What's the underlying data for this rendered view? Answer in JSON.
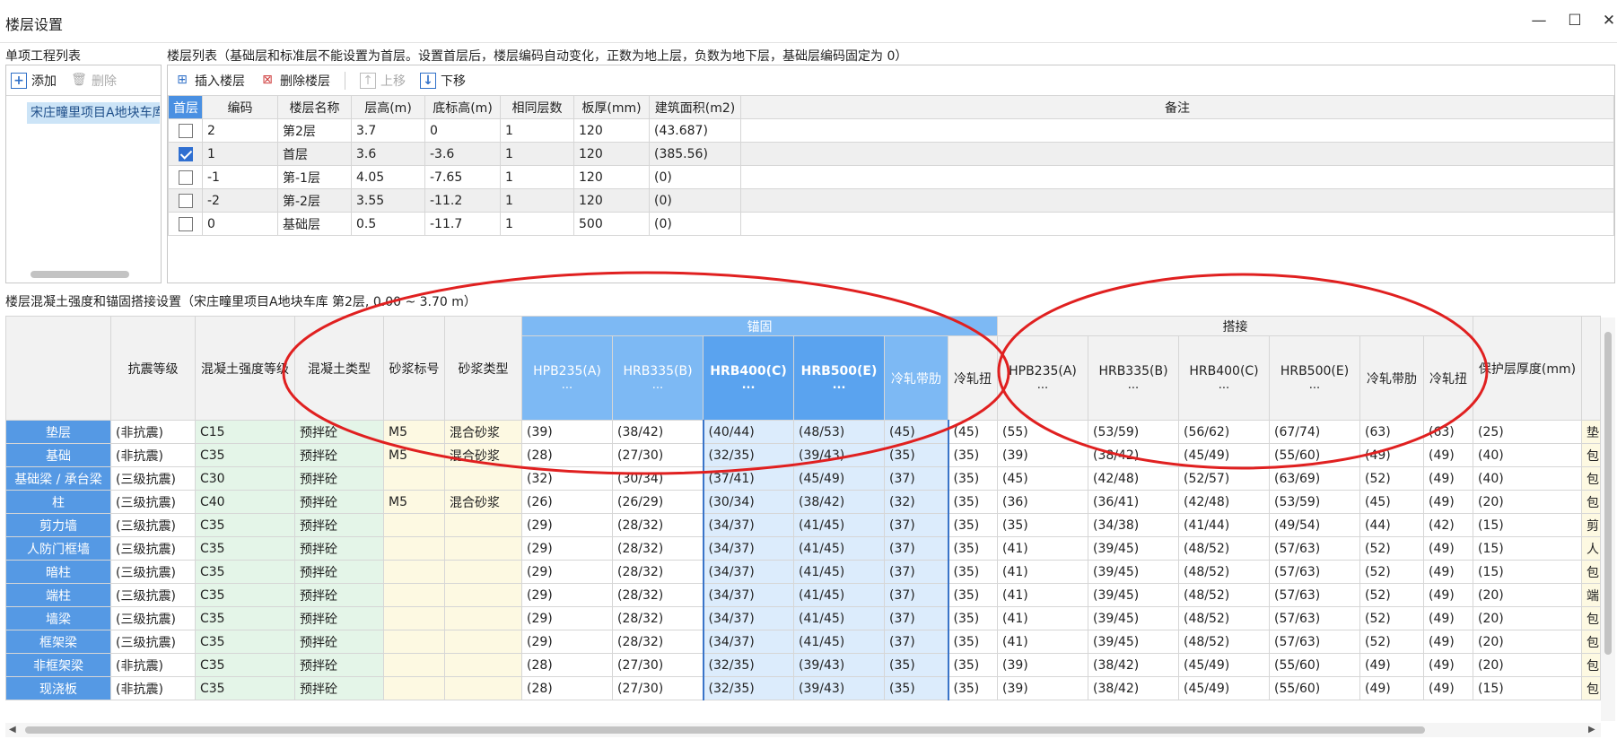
{
  "window": {
    "title": "楼层设置",
    "minimize": "—",
    "maximize": "☐",
    "close": "✕"
  },
  "project_list": {
    "label": "单项工程列表",
    "add": "添加",
    "delete": "删除",
    "items": [
      "宋庄疃里项目A地块车库"
    ]
  },
  "floor_list": {
    "label": "楼层列表（基础层和标准层不能设置为首层。设置首层后，楼层编码自动变化，正数为地上层，负数为地下层，基础层编码固定为 0）",
    "toolbar": {
      "insert": "插入楼层",
      "delete": "删除楼层",
      "up": "上移",
      "down": "下移"
    },
    "columns": [
      "首层",
      "编码",
      "楼层名称",
      "层高(m)",
      "底标高(m)",
      "相同层数",
      "板厚(mm)",
      "建筑面积(m2)",
      "备注"
    ],
    "rows": [
      {
        "first": false,
        "code": "2",
        "name": "第2层",
        "height": "3.7",
        "bottom": "0",
        "same": "1",
        "slab": "120",
        "area": "(43.687)",
        "note": ""
      },
      {
        "first": true,
        "code": "1",
        "name": "首层",
        "height": "3.6",
        "bottom": "-3.6",
        "same": "1",
        "slab": "120",
        "area": "(385.56)",
        "note": ""
      },
      {
        "first": false,
        "code": "-1",
        "name": "第-1层",
        "height": "4.05",
        "bottom": "-7.65",
        "same": "1",
        "slab": "120",
        "area": "(0)",
        "note": ""
      },
      {
        "first": false,
        "code": "-2",
        "name": "第-2层",
        "height": "3.55",
        "bottom": "-11.2",
        "same": "1",
        "slab": "120",
        "area": "(0)",
        "note": ""
      },
      {
        "first": false,
        "code": "0",
        "name": "基础层",
        "height": "0.5",
        "bottom": "-11.7",
        "same": "1",
        "slab": "500",
        "area": "(0)",
        "note": ""
      }
    ]
  },
  "concrete": {
    "label": "楼层混凝土强度和锚固搭接设置（宋庄疃里项目A地块车库   第2层, 0.00 ~ 3.70 m）",
    "group_anchor": "锚固",
    "group_lap": "搭接",
    "columns_left": [
      "抗震等级",
      "混凝土强度等级",
      "混凝土类型",
      "砂浆标号",
      "砂浆类型"
    ],
    "anchor_cols": [
      "HPB235(A)",
      "HRB335(B)",
      "HRB400(C)",
      "HRB500(E)",
      "冷轧带肋",
      "冷轧扭"
    ],
    "lap_cols": [
      "HPB235(A)",
      "HRB335(B)",
      "HRB400(C)",
      "HRB500(E)",
      "冷轧带肋",
      "冷轧扭"
    ],
    "col_ellipsis": "...",
    "cover_col": "保护层厚度(mm)",
    "rows": [
      {
        "comp": "垫层",
        "seismic": "(非抗震)",
        "grade": "C15",
        "ctype": "预拌砼",
        "mortar": "M5",
        "mtype": "混合砂浆",
        "a": [
          "(39)",
          "(38/42)",
          "(40/44)",
          "(48/53)",
          "(45)",
          "(45)"
        ],
        "l": [
          "(55)",
          "(53/59)",
          "(56/62)",
          "(67/74)",
          "(63)",
          "(63)"
        ],
        "cover": "(25)",
        "note": "垫"
      },
      {
        "comp": "基础",
        "seismic": "(非抗震)",
        "grade": "C35",
        "ctype": "预拌砼",
        "mortar": "M5",
        "mtype": "混合砂浆",
        "a": [
          "(28)",
          "(27/30)",
          "(32/35)",
          "(39/43)",
          "(35)",
          "(35)"
        ],
        "l": [
          "(39)",
          "(38/42)",
          "(45/49)",
          "(55/60)",
          "(49)",
          "(49)"
        ],
        "cover": "(40)",
        "note": "包"
      },
      {
        "comp": "基础梁 / 承台梁",
        "seismic": "(三级抗震)",
        "grade": "C30",
        "ctype": "预拌砼",
        "mortar": "",
        "mtype": "",
        "a": [
          "(32)",
          "(30/34)",
          "(37/41)",
          "(45/49)",
          "(37)",
          "(35)"
        ],
        "l": [
          "(45)",
          "(42/48)",
          "(52/57)",
          "(63/69)",
          "(52)",
          "(49)"
        ],
        "cover": "(40)",
        "note": "包"
      },
      {
        "comp": "柱",
        "seismic": "(三级抗震)",
        "grade": "C40",
        "ctype": "预拌砼",
        "mortar": "M5",
        "mtype": "混合砂浆",
        "a": [
          "(26)",
          "(26/29)",
          "(30/34)",
          "(38/42)",
          "(32)",
          "(35)"
        ],
        "l": [
          "(36)",
          "(36/41)",
          "(42/48)",
          "(53/59)",
          "(45)",
          "(49)"
        ],
        "cover": "(20)",
        "note": "包"
      },
      {
        "comp": "剪力墙",
        "seismic": "(三级抗震)",
        "grade": "C35",
        "ctype": "预拌砼",
        "mortar": "",
        "mtype": "",
        "a": [
          "(29)",
          "(28/32)",
          "(34/37)",
          "(41/45)",
          "(37)",
          "(35)"
        ],
        "l": [
          "(35)",
          "(34/38)",
          "(41/44)",
          "(49/54)",
          "(44)",
          "(42)"
        ],
        "cover": "(15)",
        "note": "剪"
      },
      {
        "comp": "人防门框墙",
        "seismic": "(三级抗震)",
        "grade": "C35",
        "ctype": "预拌砼",
        "mortar": "",
        "mtype": "",
        "a": [
          "(29)",
          "(28/32)",
          "(34/37)",
          "(41/45)",
          "(37)",
          "(35)"
        ],
        "l": [
          "(41)",
          "(39/45)",
          "(48/52)",
          "(57/63)",
          "(52)",
          "(49)"
        ],
        "cover": "(15)",
        "note": "人"
      },
      {
        "comp": "暗柱",
        "seismic": "(三级抗震)",
        "grade": "C35",
        "ctype": "预拌砼",
        "mortar": "",
        "mtype": "",
        "a": [
          "(29)",
          "(28/32)",
          "(34/37)",
          "(41/45)",
          "(37)",
          "(35)"
        ],
        "l": [
          "(41)",
          "(39/45)",
          "(48/52)",
          "(57/63)",
          "(52)",
          "(49)"
        ],
        "cover": "(15)",
        "note": "包"
      },
      {
        "comp": "端柱",
        "seismic": "(三级抗震)",
        "grade": "C35",
        "ctype": "预拌砼",
        "mortar": "",
        "mtype": "",
        "a": [
          "(29)",
          "(28/32)",
          "(34/37)",
          "(41/45)",
          "(37)",
          "(35)"
        ],
        "l": [
          "(41)",
          "(39/45)",
          "(48/52)",
          "(57/63)",
          "(52)",
          "(49)"
        ],
        "cover": "(20)",
        "note": "端"
      },
      {
        "comp": "墙梁",
        "seismic": "(三级抗震)",
        "grade": "C35",
        "ctype": "预拌砼",
        "mortar": "",
        "mtype": "",
        "a": [
          "(29)",
          "(28/32)",
          "(34/37)",
          "(41/45)",
          "(37)",
          "(35)"
        ],
        "l": [
          "(41)",
          "(39/45)",
          "(48/52)",
          "(57/63)",
          "(52)",
          "(49)"
        ],
        "cover": "(20)",
        "note": "包"
      },
      {
        "comp": "框架梁",
        "seismic": "(三级抗震)",
        "grade": "C35",
        "ctype": "预拌砼",
        "mortar": "",
        "mtype": "",
        "a": [
          "(29)",
          "(28/32)",
          "(34/37)",
          "(41/45)",
          "(37)",
          "(35)"
        ],
        "l": [
          "(41)",
          "(39/45)",
          "(48/52)",
          "(57/63)",
          "(52)",
          "(49)"
        ],
        "cover": "(20)",
        "note": "包"
      },
      {
        "comp": "非框架梁",
        "seismic": "(非抗震)",
        "grade": "C35",
        "ctype": "预拌砼",
        "mortar": "",
        "mtype": "",
        "a": [
          "(28)",
          "(27/30)",
          "(32/35)",
          "(39/43)",
          "(35)",
          "(35)"
        ],
        "l": [
          "(39)",
          "(38/42)",
          "(45/49)",
          "(55/60)",
          "(49)",
          "(49)"
        ],
        "cover": "(20)",
        "note": "包"
      },
      {
        "comp": "现浇板",
        "seismic": "(非抗震)",
        "grade": "C35",
        "ctype": "预拌砼",
        "mortar": "",
        "mtype": "",
        "a": [
          "(28)",
          "(27/30)",
          "(32/35)",
          "(39/43)",
          "(35)",
          "(35)"
        ],
        "l": [
          "(39)",
          "(38/42)",
          "(45/49)",
          "(55/60)",
          "(49)",
          "(49)"
        ],
        "cover": "(15)",
        "note": "包"
      }
    ]
  },
  "colors": {
    "accent": "#4a90e2",
    "annotation": "#e02020"
  }
}
